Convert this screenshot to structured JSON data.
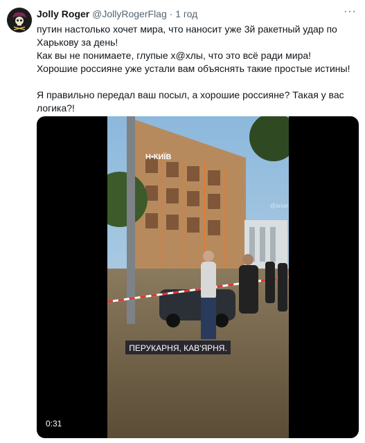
{
  "tweet": {
    "author_name": "Jolly Roger",
    "author_handle": "@JollyRogerFlag",
    "separator": "·",
    "time": "1 год",
    "more": "···",
    "text_lines": [
      "путин настолько хочет мира, что наносит уже 3й ракетный удар по Харькову за день!",
      "Как вы не понимаете, глупые х@хлы, что это всё ради мира!",
      "Хорошие россияне уже устали вам объяснять такие простые истины!",
      "Я правильно передал ваш посыл, а хорошие россияне? Такая у вас логика?!"
    ]
  },
  "video": {
    "duration": "0:31",
    "overlay_caption": "ПЕРУКАРНЯ, КАВ'ЯРНЯ.",
    "sign_text": "Н•КИЇВ",
    "watermark": "@arseni"
  }
}
